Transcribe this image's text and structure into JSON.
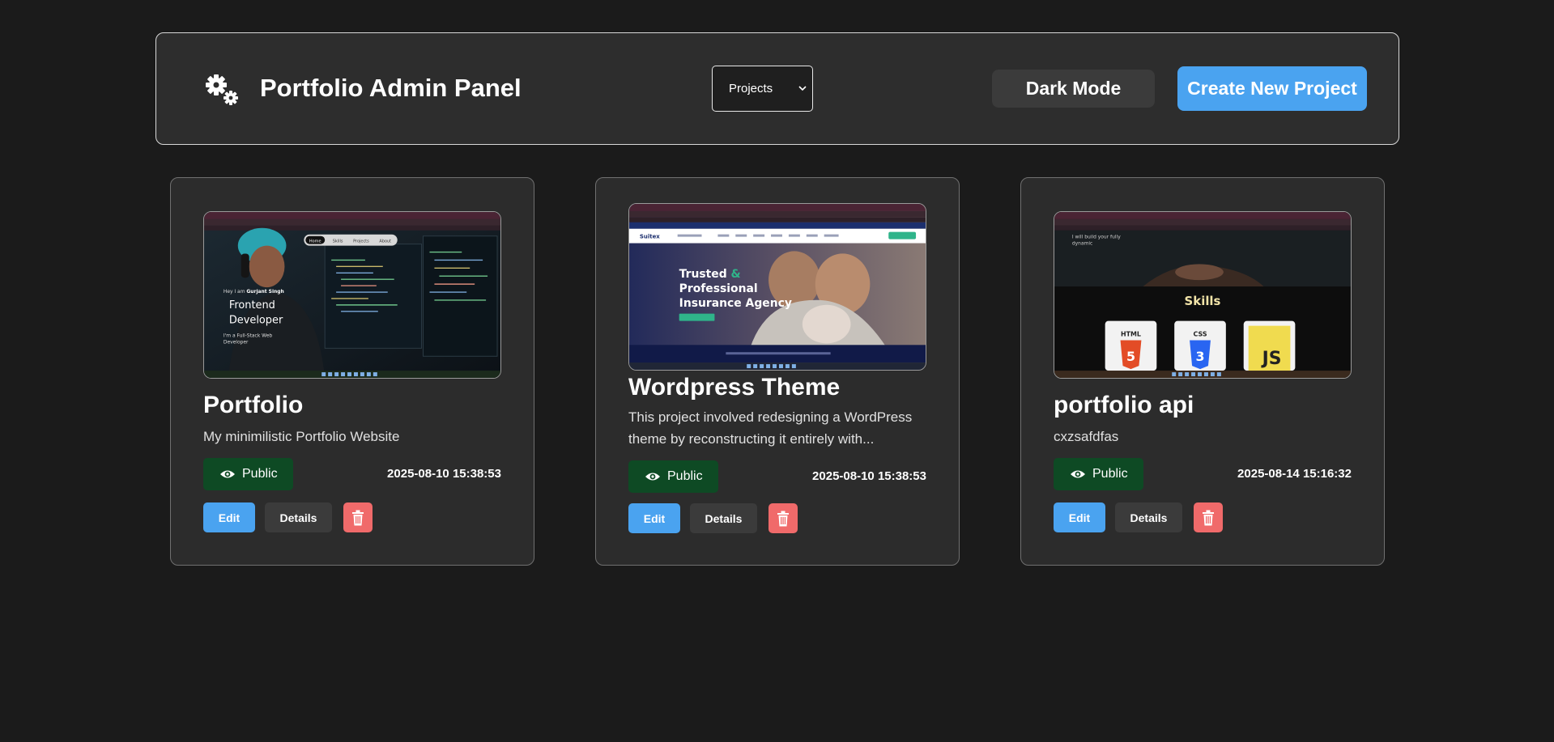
{
  "header": {
    "title": "Portfolio Admin Panel",
    "logo_icon": "gears-icon",
    "view_select": {
      "value": "Projects",
      "options": [
        "Projects"
      ]
    },
    "dark_mode_label": "Dark Mode",
    "create_label": "Create New Project"
  },
  "colors": {
    "background": "#1b1b1b",
    "panel": "#2d2d2d",
    "accent": "#4aa3f0",
    "public_badge": "#0e4a24",
    "delete": "#f06a6a"
  },
  "projects": [
    {
      "title": "Portfolio",
      "description": "My minimilistic Portfolio Website",
      "visibility": "Public",
      "date": "2025-08-10 15:38:53",
      "edit_label": "Edit",
      "details_label": "Details",
      "thumbnail": {
        "nav": [
          "Home",
          "Skills",
          "Projects",
          "About"
        ],
        "greeting_prefix": "Hey I am",
        "greeting_name": "Gurjant Singh",
        "role_line1": "Frontend",
        "role_line2": "Developer",
        "sub_line1": "I'm a Full-Stack Web",
        "sub_line2": "Developer"
      }
    },
    {
      "title": "Wordpress Theme",
      "description": "This project involved redesigning a WordPress theme by reconstructing it entirely with...",
      "visibility": "Public",
      "date": "2025-08-10 15:38:53",
      "edit_label": "Edit",
      "details_label": "Details",
      "thumbnail": {
        "brand": "Suitex",
        "hero_line1_a": "Trusted",
        "hero_line1_b": "&",
        "hero_line2": "Professional",
        "hero_line3": "Insurance Agency"
      }
    },
    {
      "title": "portfolio api",
      "description": "cxzsafdfas",
      "visibility": "Public",
      "date": "2025-08-14 15:16:32",
      "edit_label": "Edit",
      "details_label": "Details",
      "thumbnail": {
        "caption_line1": "I will build your fully",
        "caption_line2": "dynamic",
        "section_title": "Skills",
        "skill1": "HTML",
        "skill2": "CSS",
        "skill3": "JS"
      }
    }
  ]
}
